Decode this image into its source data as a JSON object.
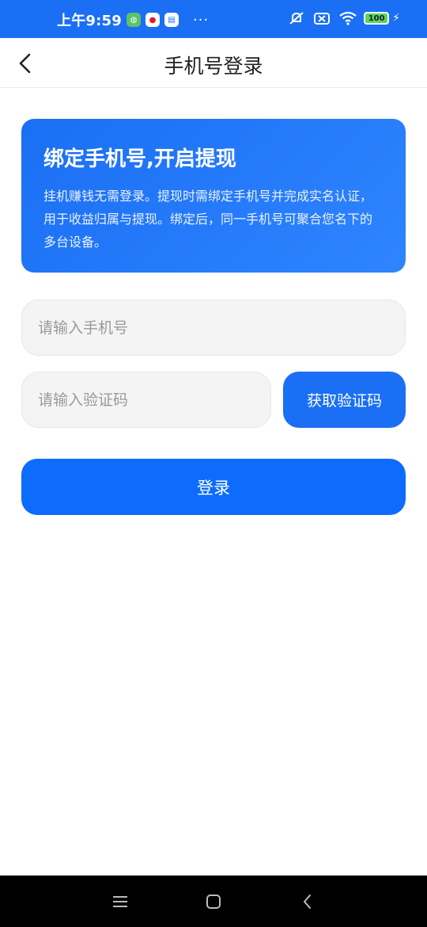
{
  "status_bar": {
    "time": "上午9:59",
    "dots": "···",
    "battery": "100"
  },
  "header": {
    "title": "手机号登录"
  },
  "banner": {
    "title": "绑定手机号,开启提现",
    "description": "挂机赚钱无需登录。提现时需绑定手机号并完成实名认证，用于收益归属与提现。绑定后，同一手机号可聚合您名下的多台设备。"
  },
  "form": {
    "phone_placeholder": "请输入手机号",
    "code_placeholder": "请输入验证码",
    "get_code_label": "获取验证码",
    "login_label": "登录"
  },
  "colors": {
    "primary": "#1a6ff4",
    "status_bar": "#1a6ff4",
    "nav_bar": "#000000"
  }
}
